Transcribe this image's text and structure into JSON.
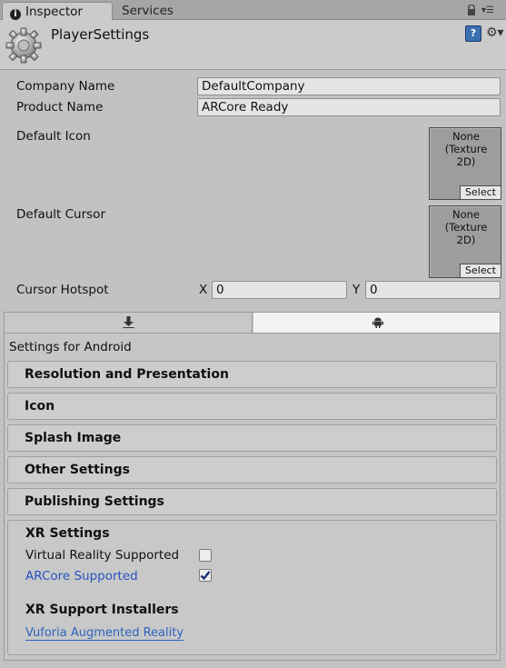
{
  "tabs": {
    "inspector": "Inspector",
    "services": "Services"
  },
  "header": {
    "title": "PlayerSettings"
  },
  "fields": {
    "company_label": "Company Name",
    "company_value": "DefaultCompany",
    "product_label": "Product Name",
    "product_value": "ARCore Ready",
    "default_icon_label": "Default Icon",
    "default_cursor_label": "Default Cursor",
    "texture_none": "None\n(Texture\n2D)",
    "select_label": "Select",
    "cursor_hotspot_label": "Cursor Hotspot",
    "x_label": "X",
    "x_value": "0",
    "y_label": "Y",
    "y_value": "0"
  },
  "platform": {
    "settings_for": "Settings for Android",
    "icons": [
      "download-arrow-icon",
      "android-icon"
    ],
    "selected": "android"
  },
  "sections": [
    "Resolution and Presentation",
    "Icon",
    "Splash Image",
    "Other Settings",
    "Publishing Settings"
  ],
  "xr": {
    "title": "XR Settings",
    "vr_label": "Virtual Reality Supported",
    "vr_checked": false,
    "arcore_label": "ARCore Supported",
    "arcore_checked": true,
    "installers_title": "XR Support Installers",
    "vuforia_link": "Vuforia Augmented Reality"
  },
  "colors": {
    "accent_blue": "#2753c0",
    "background": "#c2c2c2"
  }
}
